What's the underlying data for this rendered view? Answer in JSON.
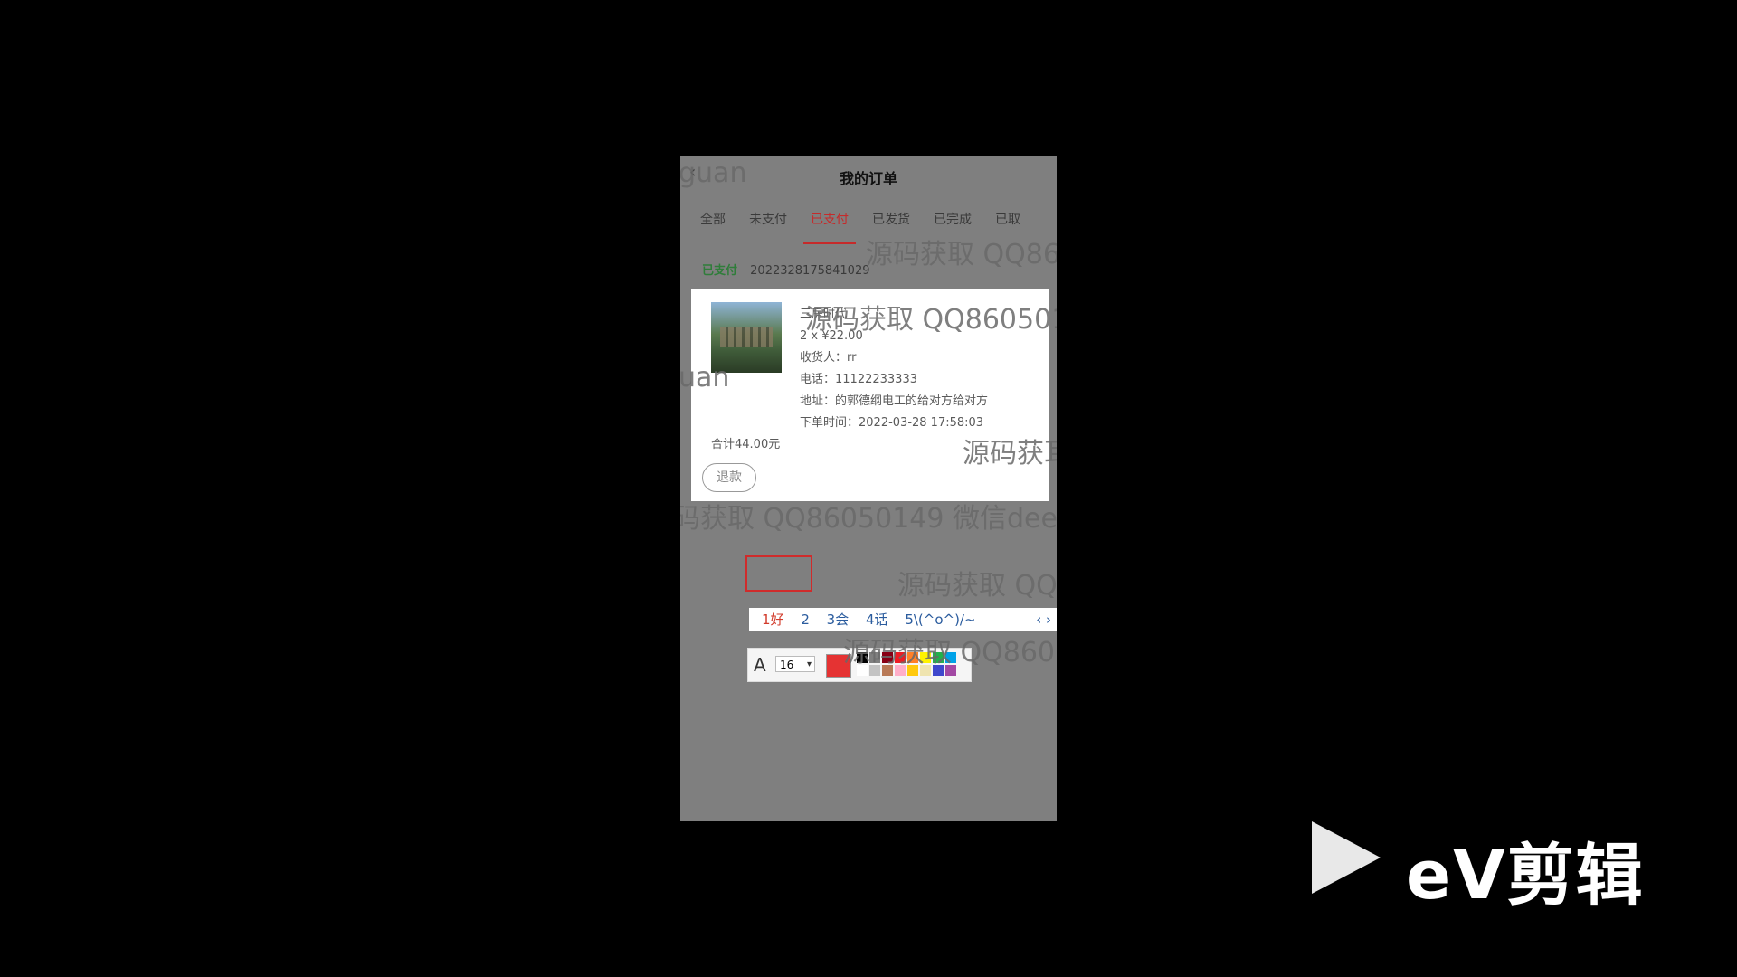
{
  "nav": {
    "title": "我的订单",
    "back_icon": "‹"
  },
  "tabs": [
    "全部",
    "未支付",
    "已支付",
    "已发货",
    "已完成",
    "已取"
  ],
  "order": {
    "status": "已支付",
    "order_no": "2022328175841029",
    "product_name": "三房时代",
    "price_line": "2 x ¥22.00",
    "receiver": "收货人：rr",
    "phone": "电话：11122233333",
    "address": "地址：的郭德纲电工的给对方给对方",
    "time": "下单时间：2022-03-28 17:58:03",
    "total": "合计44.00元",
    "refund_label": "退款"
  },
  "ime": {
    "candidates": [
      "1好",
      "2",
      "3会",
      "4话",
      "5\\(^o^)/~"
    ],
    "arrows": "‹ ›"
  },
  "toolbar": {
    "font_icon": "A",
    "font_size": "16",
    "current_color": "#e53333"
  },
  "palette": [
    "#000000",
    "#7f7f7f",
    "#880015",
    "#ed1c24",
    "#ff7f27",
    "#fff200",
    "#22b14c",
    "#00a2e8",
    "#ffffff",
    "#c3c3c3",
    "#b97a57",
    "#ffaec9",
    "#ffc90e",
    "#efe4b0",
    "#3f48cc",
    "#a349a4"
  ],
  "watermarks": [
    {
      "text": "guan",
      "cls": "wm-a"
    },
    {
      "text": "源码获取 QQ86",
      "cls": "wm-b"
    },
    {
      "text": "源码获取 QQ860501",
      "cls": "wm-c"
    },
    {
      "text": "uan",
      "cls": "wm-d"
    },
    {
      "text": "源码获耳",
      "cls": "wm-e"
    },
    {
      "text": "码获取 QQ86050149 微信dee",
      "cls": "wm-f"
    },
    {
      "text": "源码获取 QQ",
      "cls": "wm-g"
    },
    {
      "text": "源码获取 QQ860!",
      "cls": "wm-h"
    }
  ],
  "branding": {
    "text": "eV剪辑"
  }
}
